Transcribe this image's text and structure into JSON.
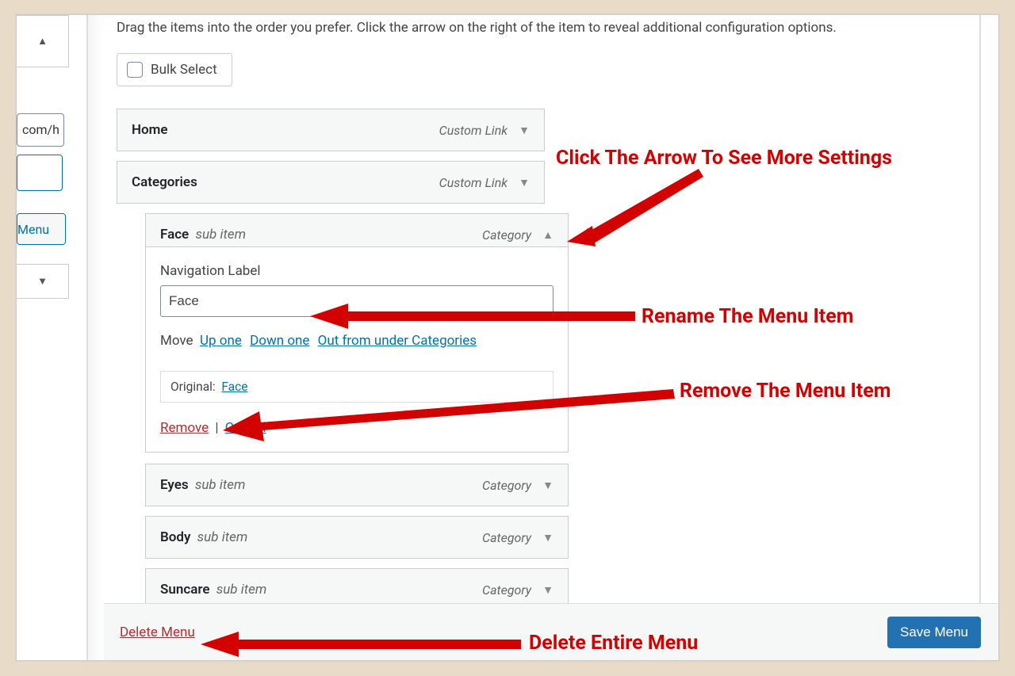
{
  "help_text": "Drag the items into the order you prefer. Click the arrow on the right of the item to reveal additional configuration options.",
  "bulk_select": "Bulk Select",
  "sidebar": {
    "url_fragment": "com/h",
    "menu_button": " Menu"
  },
  "items": {
    "home": {
      "title": "Home",
      "type": "Custom Link"
    },
    "categories": {
      "title": "Categories",
      "type": "Custom Link"
    },
    "face": {
      "title": "Face",
      "sub": "sub item",
      "type": "Category"
    },
    "eyes": {
      "title": "Eyes",
      "sub": "sub item",
      "type": "Category"
    },
    "body": {
      "title": "Body",
      "sub": "sub item",
      "type": "Category"
    },
    "suncare": {
      "title": "Suncare",
      "sub": "sub item",
      "type": "Category"
    }
  },
  "expanded": {
    "nav_label_label": "Navigation Label",
    "nav_label_value": "Face",
    "move_label": "Move",
    "move_up": "Up one",
    "move_down": "Down one",
    "move_out": "Out from under Categories",
    "original_label": "Original:",
    "original_link": "Face",
    "remove": "Remove",
    "cancel": "Cancel"
  },
  "footer": {
    "delete": "Delete Menu",
    "save": "Save Menu"
  },
  "annotations": {
    "a1": "Click The Arrow To See More Settings",
    "a2": "Rename The Menu Item",
    "a3": "Remove The Menu Item",
    "a4": "Delete Entire Menu"
  }
}
